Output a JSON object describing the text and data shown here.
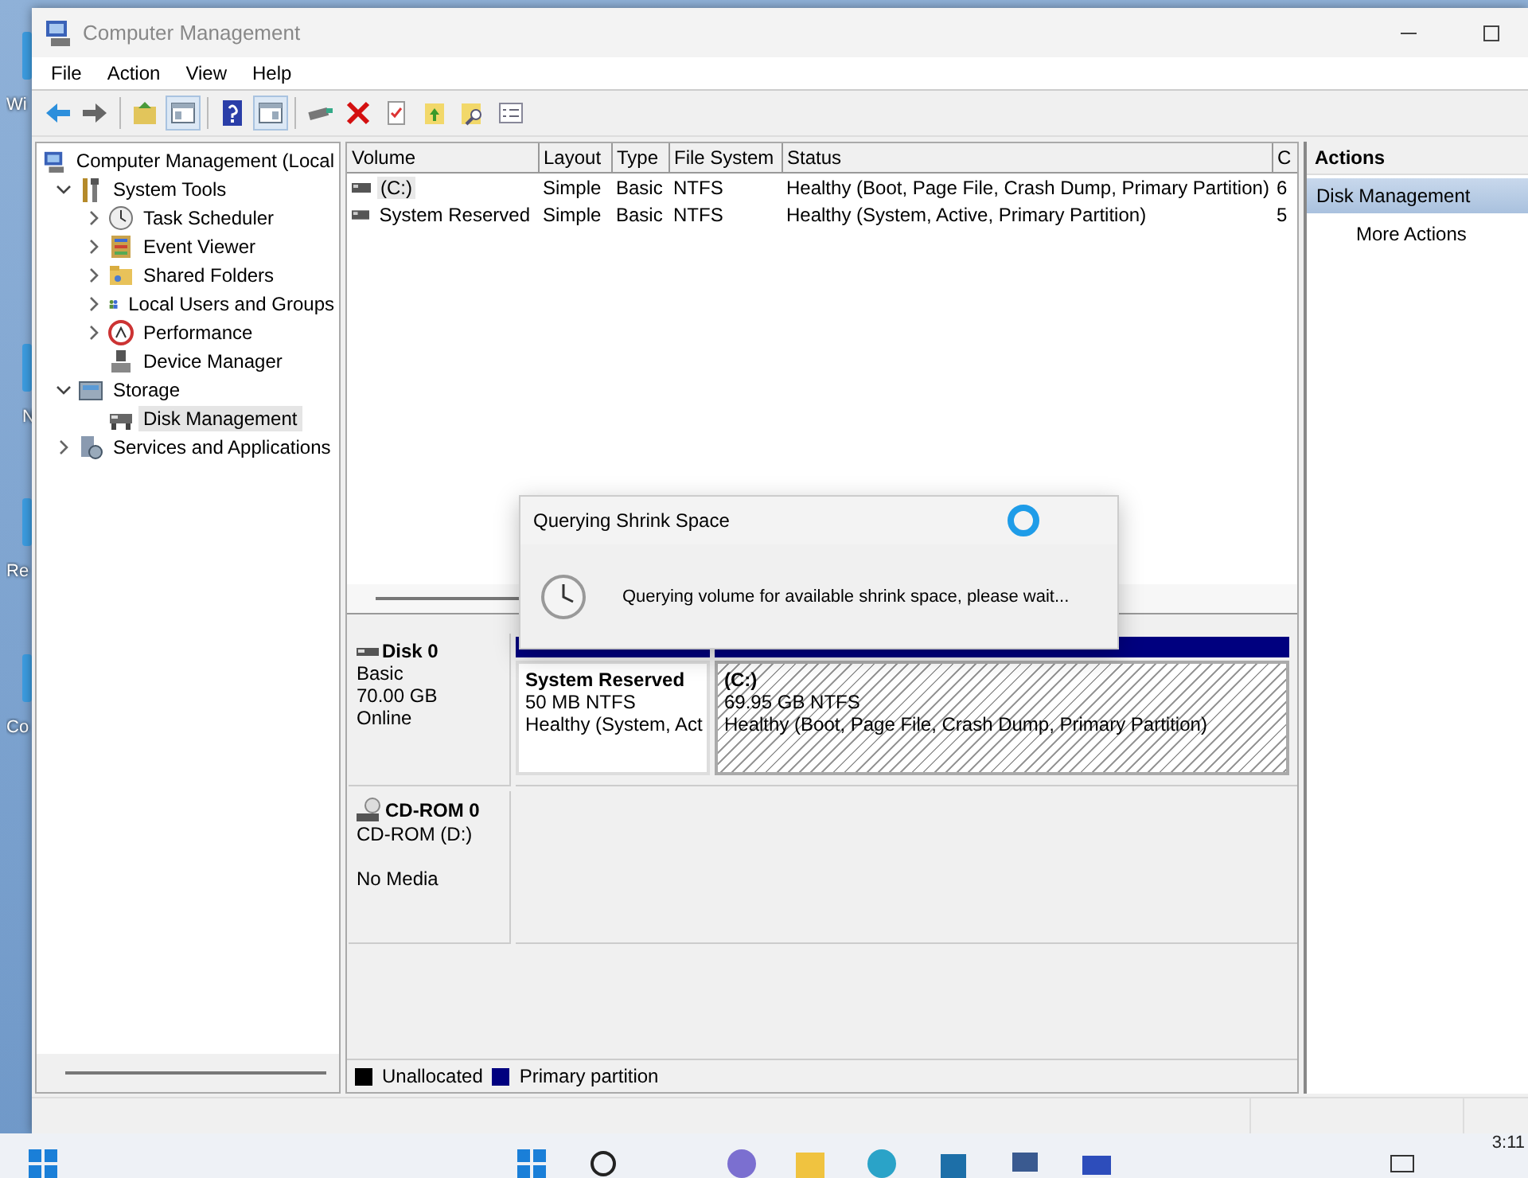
{
  "desktop": {
    "labels": [
      "Wi",
      "N",
      "Re",
      "Co"
    ]
  },
  "window": {
    "title": "Computer Management"
  },
  "menu": [
    {
      "label": "File"
    },
    {
      "label": "Action"
    },
    {
      "label": "View"
    },
    {
      "label": "Help"
    }
  ],
  "toolbar": [
    [
      {
        "pressed": false
      },
      {
        "pressed": false
      }
    ],
    [
      {
        "pressed": false
      },
      {
        "pressed": true
      }
    ],
    [
      {
        "pressed": false
      },
      {
        "pressed": true
      }
    ],
    [
      {
        "pressed": false
      },
      {
        "pressed": false
      },
      {
        "pressed": false
      },
      {
        "pressed": false
      },
      {
        "pressed": false
      },
      {
        "pressed": false
      }
    ]
  ],
  "tree": [
    {
      "label": "Computer Management (Local",
      "selected": false,
      "children": [
        {
          "label": "System Tools",
          "expanded": true,
          "selected": false,
          "children": [
            {
              "label": "Task Scheduler",
              "expanded": false,
              "selected": false
            },
            {
              "label": "Event Viewer",
              "expanded": false,
              "selected": false
            },
            {
              "label": "Shared Folders",
              "expanded": false,
              "selected": false
            },
            {
              "label": "Local Users and Groups",
              "expanded": false,
              "selected": false
            },
            {
              "label": "Performance",
              "expanded": false,
              "selected": false
            },
            {
              "label": "Device Manager",
              "selected": false
            }
          ]
        },
        {
          "label": "Storage",
          "expanded": true,
          "selected": false,
          "children": [
            {
              "label": "Disk Management",
              "selected": true
            }
          ]
        },
        {
          "label": "Services and Applications",
          "expanded": false,
          "selected": false
        }
      ]
    }
  ],
  "volumes": {
    "columns": [
      "Volume",
      "Layout",
      "Type",
      "File System",
      "Status",
      "C"
    ],
    "rows": [
      {
        "cells": [
          "(C:)",
          "Simple",
          "Basic",
          "NTFS",
          "Healthy (Boot, Page File, Crash Dump, Primary Partition)",
          "6"
        ],
        "selected": true
      },
      {
        "cells": [
          "System Reserved",
          "Simple",
          "Basic",
          "NTFS",
          "Healthy (System, Active, Primary Partition)",
          "5"
        ],
        "selected": false
      }
    ]
  },
  "disks": [
    {
      "kind": "disk",
      "name": "Disk 0",
      "lines": [
        "Basic",
        "70.00 GB",
        "Online"
      ],
      "partitions": [
        {
          "title": "System Reserved",
          "size": "50 MB NTFS",
          "status": "Healthy (System, Act",
          "selected": false
        },
        {
          "title": "(C:)",
          "size": "69.95 GB NTFS",
          "status": "Healthy (Boot, Page File, Crash Dump, Primary Partition)",
          "selected": true
        }
      ]
    },
    {
      "kind": "cdrom",
      "name": "CD-ROM 0",
      "lines": [
        "CD-ROM (D:)"
      ],
      "media": "No Media"
    }
  ],
  "legend": [
    {
      "label": "Unallocated",
      "color": "#000000"
    },
    {
      "label": "Primary partition",
      "color": "#00007f"
    }
  ],
  "actions": {
    "header": "Actions",
    "section": "Disk Management",
    "items": [
      "More Actions"
    ]
  },
  "dialog": {
    "title": "Querying Shrink Space",
    "message": "Querying volume for available shrink space, please wait..."
  },
  "taskbar": {
    "clock": "3:11"
  }
}
